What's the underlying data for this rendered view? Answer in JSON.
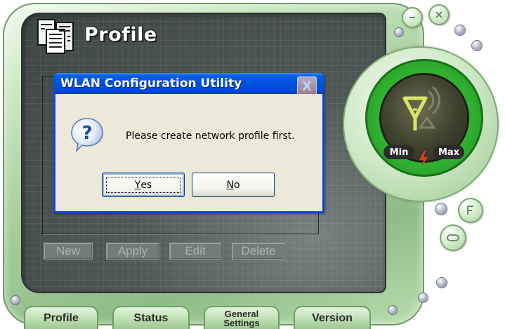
{
  "app": {
    "page_title": "Profile",
    "actions": {
      "new": "New",
      "apply": "Apply",
      "edit": "Edit",
      "delete": "Delete"
    },
    "tabs": [
      {
        "label": "Profile"
      },
      {
        "label": "Status"
      },
      {
        "label_line1": "General",
        "label_line2": "Settings"
      },
      {
        "label": "Version"
      }
    ],
    "meter": {
      "min_label": "Min",
      "max_label": "Max"
    },
    "window_controls": {
      "minimize_icon": "minus",
      "close_icon": "x"
    },
    "side_controls": {
      "compact_icon": "F",
      "link_icon": "link"
    }
  },
  "dialog": {
    "title": "WLAN Configuration Utility",
    "close_label": "X",
    "icon": "question-icon",
    "message": "Please create network profile first.",
    "yes_mnemonic": "Y",
    "yes_rest": "es",
    "no_mnemonic": "N",
    "no_rest": "o"
  },
  "colors": {
    "skin_green": "#a9cf9f",
    "panel_dark": "#4f5856",
    "xp_title_blue": "#0054e3",
    "dialog_face": "#ece9d8",
    "signal_green": "#2fae2f",
    "antenna_yellow": "#d9e56a"
  }
}
